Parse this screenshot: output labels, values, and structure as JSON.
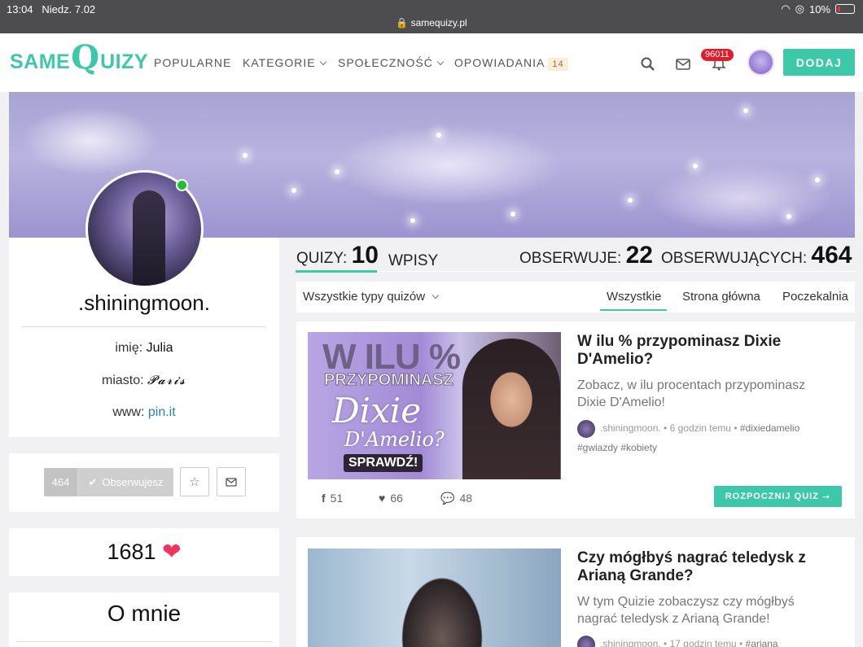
{
  "status_bar": {
    "time": "13:04",
    "date": "Niedz. 7.02",
    "url": "samequizy.pl",
    "battery": "10%"
  },
  "nav": {
    "logo_left": "SAME",
    "logo_q": "Q",
    "logo_right": "UIZY",
    "items": [
      "POPULARNE",
      "KATEGORIE",
      "SPOŁECZNOŚĆ",
      "OPOWIADANIA"
    ],
    "opowiadania_count": "14",
    "notifications": "96011",
    "add_label": "DODAJ"
  },
  "profile": {
    "username": ".shiningmoon.",
    "imie_label": "imię:",
    "imie": "Julia",
    "miasto_label": "miasto:",
    "miasto": "𝓟𝓪𝓻𝓲𝓼",
    "www_label": "www:",
    "www": "pin.it",
    "followers_count": "464",
    "follow_label": "Obserwujesz",
    "likes": "1681",
    "about_title": "O mnie"
  },
  "stats": {
    "quizy_label": "QUIZY:",
    "quizy": "10",
    "wpisy_label": "WPISY",
    "obserwuje_label": "OBSERWUJE:",
    "obserwuje": "22",
    "obserwujacych_label": "OBSERWUJĄCYCH:",
    "obserwujacych": "464"
  },
  "filter": {
    "select": "Wszystkie typy quizów",
    "tabs": [
      "Wszystkie",
      "Strona główna",
      "Poczekalnia"
    ]
  },
  "quizzes": [
    {
      "title": "W ilu % przypominasz Dixie D'Amelio?",
      "desc": "Zobacz, w ilu procentach przypominasz Dixie D'Amelio!",
      "author": ".shiningmoon.",
      "time": "6 godzin temu",
      "tags1": "#dixiedamelio",
      "tags2": "#gwiazdy #kobiety",
      "shares": "51",
      "likes": "66",
      "comments": "48",
      "start_label": "ROZPOCZNIJ QUIZ",
      "thumb_text": {
        "t1": "W ILU %",
        "t2": "PRZYPOMINASZ",
        "t3": "Dixie",
        "t4": "D'Amelio?",
        "t5": "SPRAWDŹ!"
      }
    },
    {
      "title": "Czy mógłbyś nagrać teledysk z Arianą Grande?",
      "desc": "W tym Quizie zobaczysz czy mógłbyś nagrać teledysk z Arianą Grande!",
      "author": ".shiningmoon.",
      "time": "17 godzin temu",
      "tags1": "#ariana"
    }
  ]
}
